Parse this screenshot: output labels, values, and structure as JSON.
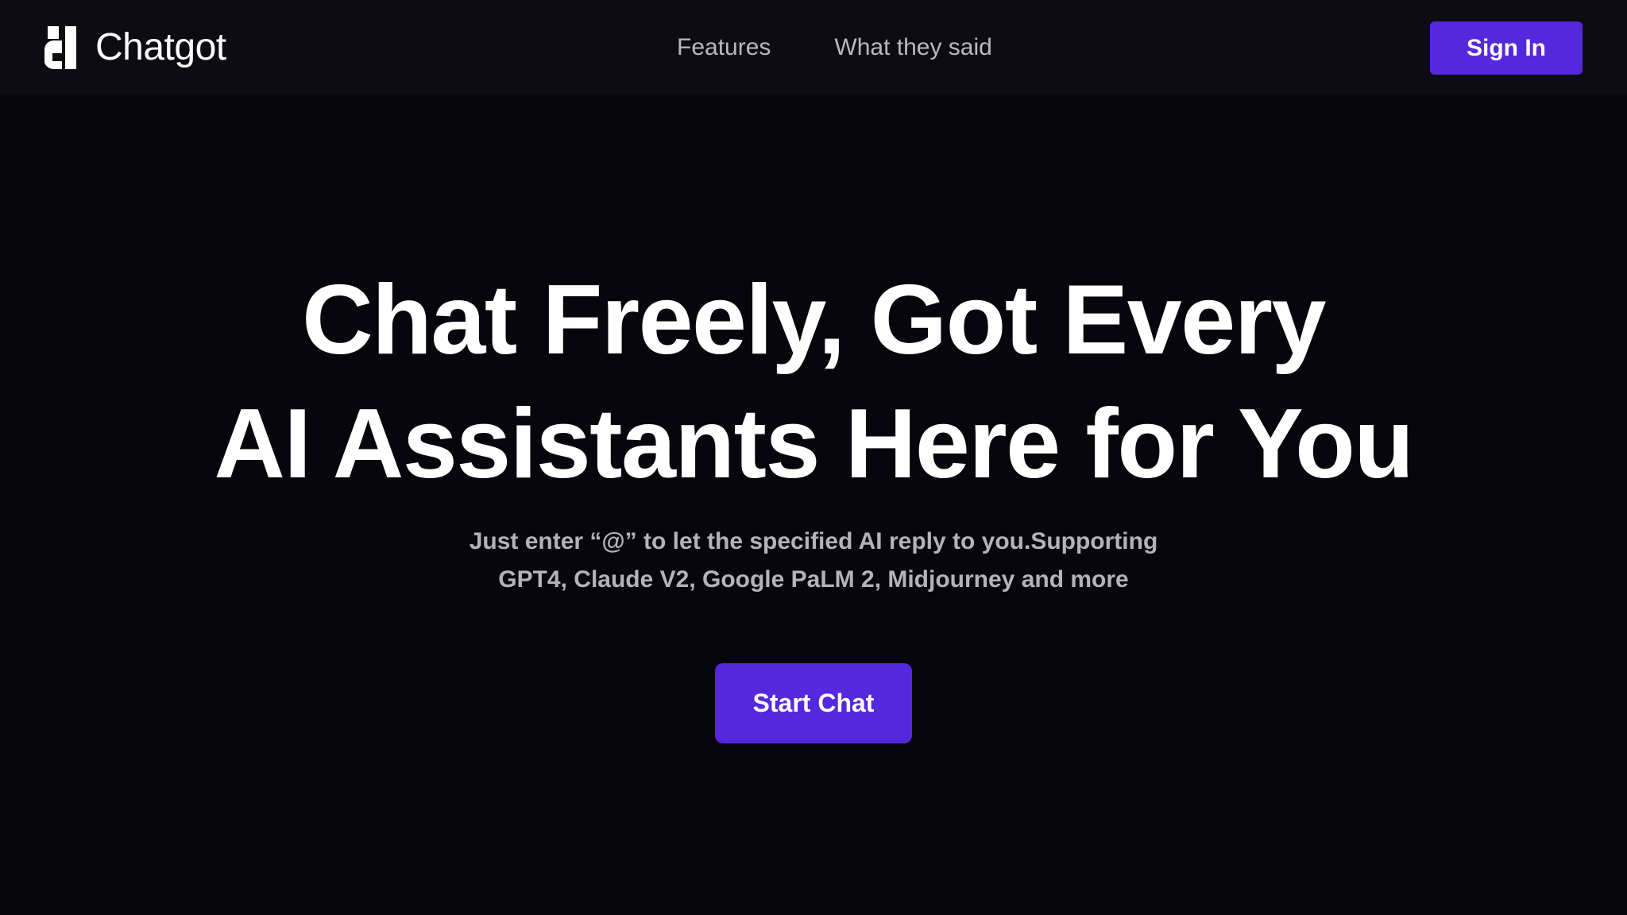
{
  "header": {
    "brand": "Chatgot",
    "logo_icon": "chatgot-logo-icon",
    "nav": [
      {
        "label": "Features"
      },
      {
        "label": "What they said"
      }
    ],
    "signin_label": "Sign In"
  },
  "hero": {
    "title_line1": "Chat Freely, Got Every",
    "title_line2_a": "AI Assistants ",
    "title_line2_b": "Here for You",
    "subtitle_line1": "Just enter “@” to let the specified AI reply to you.Supporting",
    "subtitle_line2": "GPT4, Claude V2, Google PaLM 2, Midjourney and more",
    "cta_label": "Start Chat"
  },
  "colors": {
    "background": "#07060d",
    "header_background": "#0d0c12",
    "accent": "#5528dd",
    "text_primary": "#ffffff",
    "text_secondary": "#b4b3bd"
  }
}
